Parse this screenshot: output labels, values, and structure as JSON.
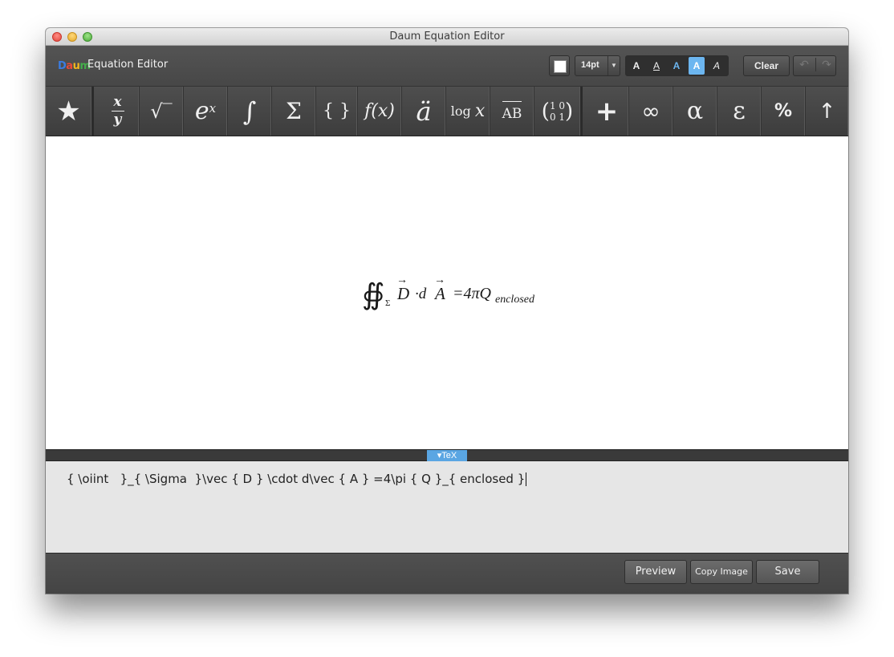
{
  "window": {
    "title": "Daum Equation Editor"
  },
  "app": {
    "logo": "Daum",
    "name": "Equation Editor"
  },
  "toolbar": {
    "color_swatch": "#ffffff",
    "font_size": "14pt",
    "style_buttons": [
      "A",
      "A",
      "A",
      "A",
      "A"
    ],
    "clear_label": "Clear",
    "undo_icon": "undo-icon",
    "redo_icon": "redo-icon"
  },
  "symbols": [
    {
      "name": "favorites",
      "icon": "star-icon",
      "glyph": "★"
    },
    {
      "name": "fraction",
      "glyph_top": "x",
      "glyph_bottom": "y"
    },
    {
      "name": "root",
      "glyph": "√‾"
    },
    {
      "name": "exponent",
      "glyph_base": "e",
      "glyph_sup": "x"
    },
    {
      "name": "integral",
      "glyph": "∫"
    },
    {
      "name": "summation",
      "glyph": "Σ"
    },
    {
      "name": "brackets",
      "glyph": "{ }"
    },
    {
      "name": "function",
      "glyph": "f(x)"
    },
    {
      "name": "accent",
      "glyph": "ä"
    },
    {
      "name": "logarithm",
      "glyph_fn": "log",
      "glyph_var": "x"
    },
    {
      "name": "vector",
      "glyph": "AB"
    },
    {
      "name": "matrix",
      "glyph_row1": "1 0",
      "glyph_row2": "0 1"
    },
    {
      "name": "operators",
      "glyph": "+"
    },
    {
      "name": "infinity",
      "glyph": "∞"
    },
    {
      "name": "greek-lower",
      "glyph": "α"
    },
    {
      "name": "greek-epsilon",
      "glyph": "ε"
    },
    {
      "name": "percent",
      "glyph": "%"
    },
    {
      "name": "arrows",
      "glyph": "↑"
    }
  ],
  "equation": {
    "integral": "∯",
    "subscript": "Σ",
    "vec_d": "D",
    "dot": "·d",
    "vec_a": "A",
    "rhs": "=4πQ",
    "rhs_sub": "enclosed"
  },
  "tex": {
    "tab_label": "▾TeX",
    "code": "{ \\oiint   }_{ \\Sigma  }\\vec { D } \\cdot d\\vec { A } =4\\pi { Q }_{ enclosed }"
  },
  "footer": {
    "preview_label": "Preview",
    "copy_label": "Copy Image",
    "save_label": "Save"
  }
}
